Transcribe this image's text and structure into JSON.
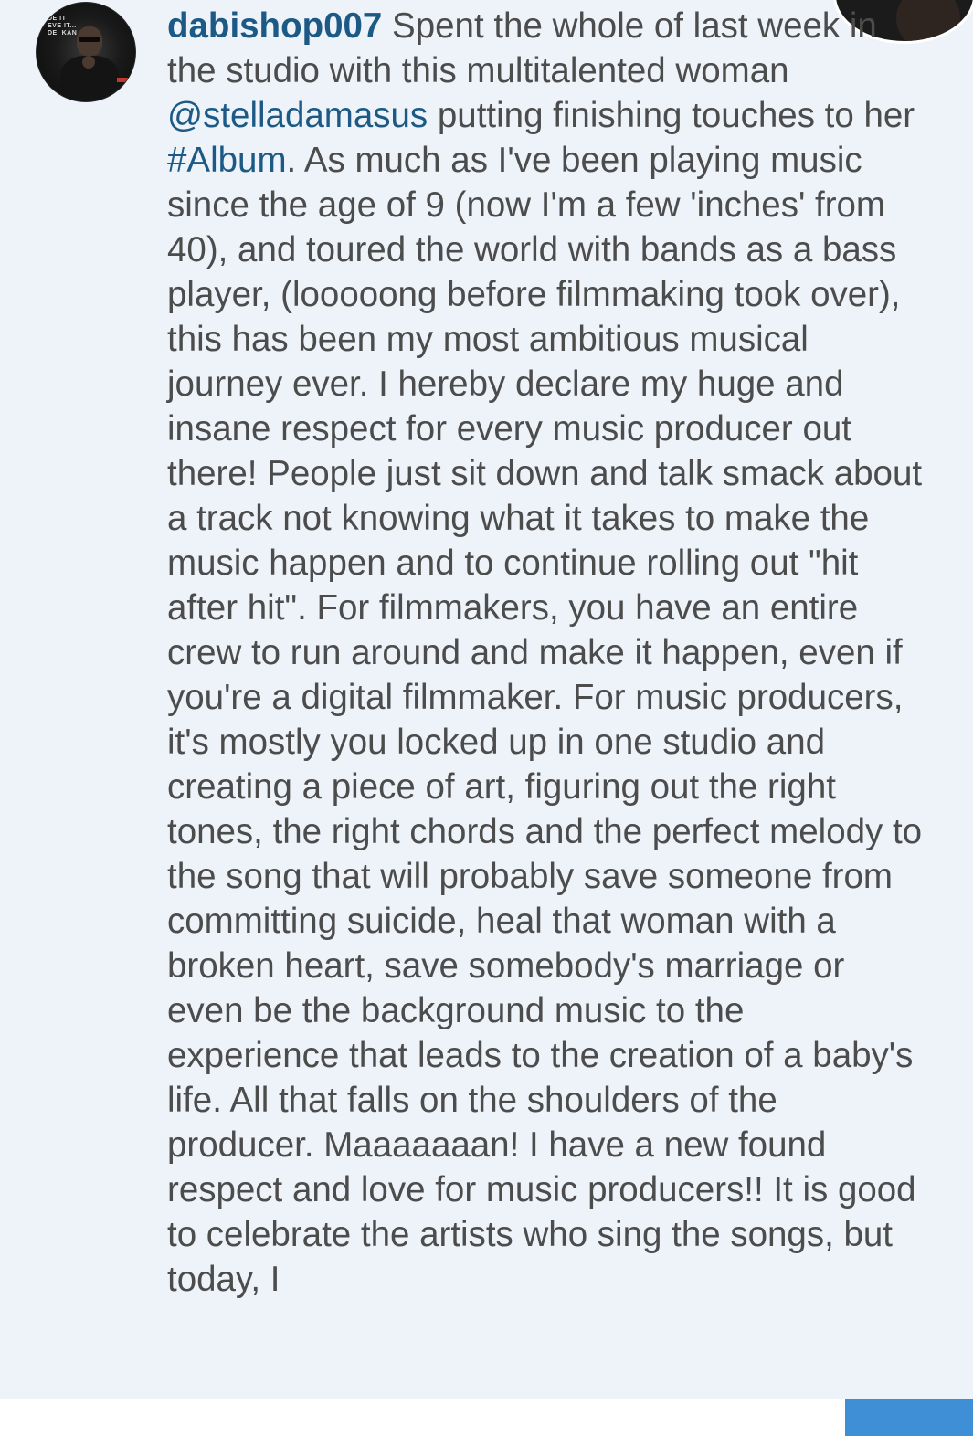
{
  "post": {
    "username": "dabishop007",
    "caption_segments": [
      {
        "type": "text",
        "text": " Spent the whole of last week in the studio with this multitalented woman "
      },
      {
        "type": "mention",
        "text": "@stelladamasus"
      },
      {
        "type": "text",
        "text": " putting finishing touches to her "
      },
      {
        "type": "hashtag",
        "text": "#Album"
      },
      {
        "type": "text",
        "text": ". As much as I've been playing music since the age of 9 (now I'm a few 'inches' from 40), and toured the world with bands as a bass player, (looooong before filmmaking took over), this has been my most ambitious musical journey ever. I hereby declare my huge and insane respect for every music producer out there! People just sit down and talk smack about a track not knowing what it takes to make the music happen and to continue rolling out \"hit after hit\". For filmmakers, you have an entire crew to run around and make it happen, even if you're a digital filmmaker. For music producers, it's mostly you locked up in one studio and creating a piece of art, figuring out the right tones, the right chords and the perfect melody to the song that will probably save someone from committing suicide, heal that woman with a broken heart, save somebody's marriage or even be the background music to the experience that leads to the creation of a baby's life. All that falls on the shoulders of the producer. Maaaaaaan! I have a new found respect and love for music producers!! It is good to celebrate the artists who sing the songs, but today, I"
      }
    ],
    "avatar_poster_text": "DE IT\nEVE IT...\nDE  KAN"
  },
  "colors": {
    "background": "#edf3f9",
    "text": "#4c4c4c",
    "link": "#1c5a85",
    "send_button": "#3f8fd6"
  },
  "icons": {
    "avatar": "user-avatar",
    "corner_avatar": "profile-avatar"
  }
}
